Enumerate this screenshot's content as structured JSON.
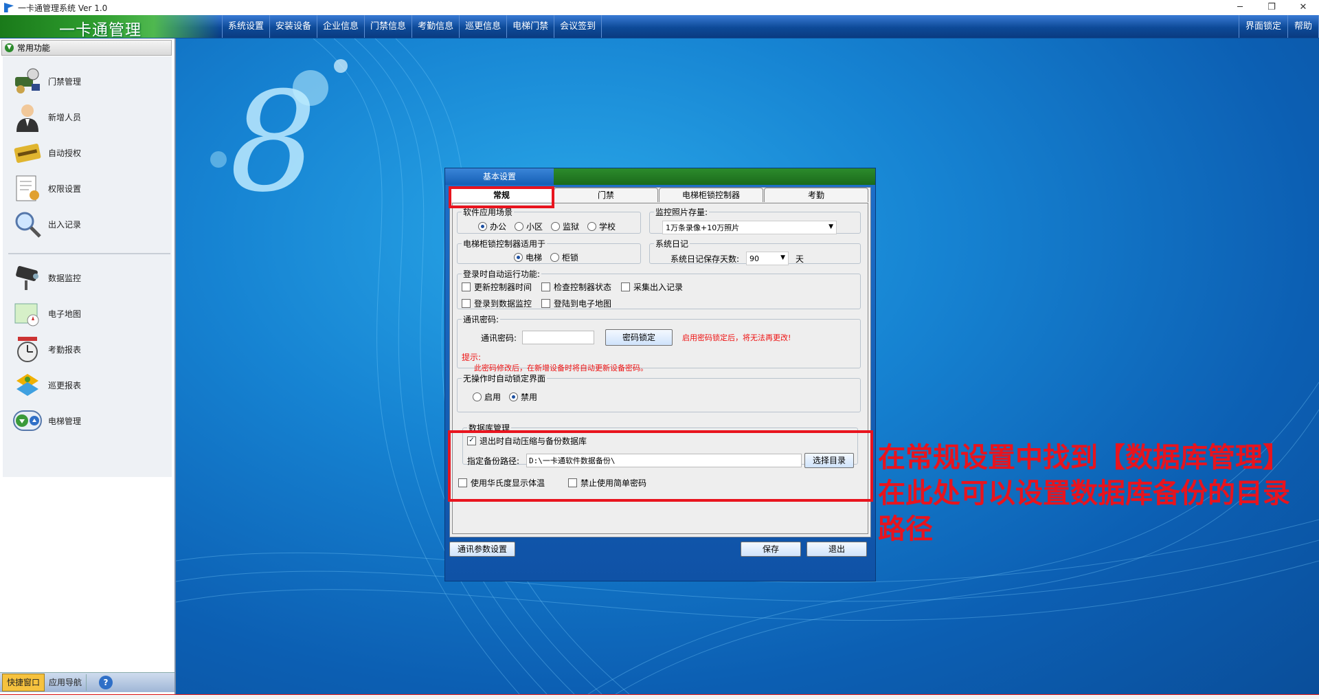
{
  "window": {
    "title": "一卡通管理系统  Ver 1.0",
    "controls": [
      "─",
      "❐",
      "✕"
    ]
  },
  "menubar": {
    "brand": "一卡通管理",
    "items": [
      "系统设置",
      "安装设备",
      "企业信息",
      "门禁信息",
      "考勤信息",
      "巡更信息",
      "电梯门禁",
      "会议签到"
    ],
    "right": [
      "界面锁定",
      "帮助"
    ]
  },
  "sidebar": {
    "header": "常用功能",
    "items": [
      {
        "label": "门禁管理",
        "icon": "access-control-icon"
      },
      {
        "label": "新增人员",
        "icon": "person-icon"
      },
      {
        "label": "自动授权",
        "icon": "card-icon"
      },
      {
        "label": "权限设置",
        "icon": "document-icon"
      },
      {
        "label": "出入记录",
        "icon": "magnifier-icon"
      },
      {
        "label": "数据监控",
        "icon": "camera-icon"
      },
      {
        "label": "电子地图",
        "icon": "map-icon"
      },
      {
        "label": "考勤报表",
        "icon": "clock-icon"
      },
      {
        "label": "巡更报表",
        "icon": "patrol-icon"
      },
      {
        "label": "电梯管理",
        "icon": "elevator-icon"
      }
    ],
    "bottom_tabs": [
      "快捷窗口",
      "应用导航"
    ],
    "help": "?"
  },
  "dialog": {
    "title": "基本设置",
    "tabs": [
      "常规",
      "门禁",
      "电梯柜锁控制器",
      "考勤"
    ],
    "scene": {
      "legend": "软件应用场景",
      "options": [
        "办公",
        "小区",
        "监狱",
        "学校"
      ],
      "selected": "办公"
    },
    "photo": {
      "legend": "监控照片存量:",
      "value": "1万条录像+10万照片"
    },
    "elevator": {
      "legend": "电梯柜锁控制器适用于",
      "options": [
        "电梯",
        "柜锁"
      ],
      "selected": "电梯"
    },
    "syslog": {
      "legend": "系统日记",
      "label": "系统日记保存天数:",
      "value": "90",
      "unit": "天"
    },
    "autorun": {
      "legend": "登录时自动运行功能:",
      "row1": [
        "更新控制器时间",
        "检查控制器状态",
        "采集出入记录"
      ],
      "row2": [
        "登录到数据监控",
        "登陆到电子地图"
      ]
    },
    "comm": {
      "legend": "通讯密码:",
      "label": "通讯密码:",
      "value": "",
      "button": "密码锁定",
      "warning": "启用密码锁定后，将无法再更改!",
      "tip_label": "提示:",
      "tip": "此密码修改后，在新增设备时将自动更新设备密码。"
    },
    "autolock": {
      "legend": "无操作时自动锁定界面",
      "options": [
        "启用",
        "禁用"
      ],
      "selected": "禁用"
    },
    "db": {
      "legend": "数据库管理",
      "check_label": "退出时自动压缩与备份数据库",
      "checked": true,
      "path_label": "指定备份路径:",
      "path_value": "D:\\一卡通软件数据备份\\",
      "browse": "选择目录"
    },
    "misc": [
      "使用华氏度显示体温",
      "禁止使用简单密码"
    ],
    "footer": {
      "comm_settings": "通讯参数设置",
      "save": "保存",
      "exit": "退出"
    }
  },
  "annotation": [
    "在常规设置中找到【数据库管理】",
    "在此处可以设置数据库备份的目录",
    "路径"
  ],
  "colors": {
    "highlight": "#e8141e",
    "menubar": "#0d4a98",
    "brand_green": "#2f9e2f"
  }
}
